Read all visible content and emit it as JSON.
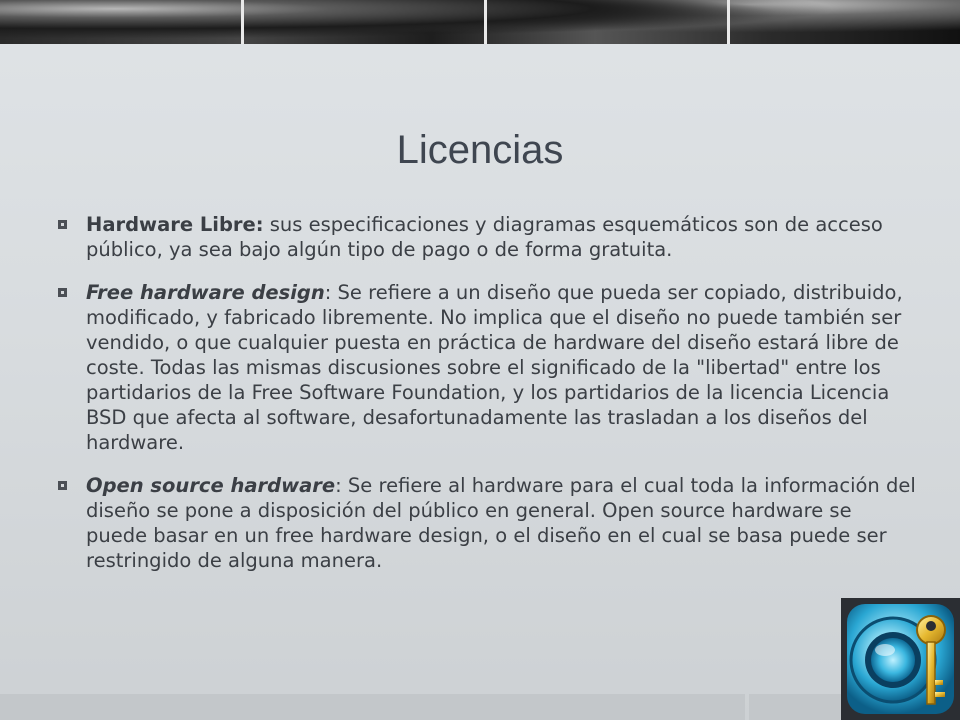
{
  "slide": {
    "title": "Licencias",
    "bullets": [
      {
        "term": "Hardware Libre:",
        "text": " sus especificaciones y diagramas esquemáticos son de acceso público, ya sea bajo algún tipo de pago o de forma gratuita."
      },
      {
        "term": "Free hardware design",
        "text": ": Se refiere a un diseño que pueda ser copiado, distribuido, modificado, y fabricado libremente. No implica que el diseño no puede también ser vendido, o que cualquier puesta en práctica de hardware del diseño estará libre de coste. Todas las mismas discusiones sobre el significado de la \"libertad\" entre los partidarios de la Free Software Foundation, y los partidarios de la licencia Licencia BSD que afecta al software, desafortunadamente las trasladan a los diseños del hardware."
      },
      {
        "term": "Open source hardware",
        "text": ": Se refiere al hardware para el cual toda la información del diseño se pone a disposición del público en general. Open source hardware se puede basar en un free hardware design, o el diseño en el cual se basa puede ser restringido de alguna manera."
      }
    ],
    "logo_icon": "key-disc-icon",
    "colors": {
      "background": "#dcdfe2",
      "title": "#3f4650",
      "text": "#3b3f45"
    }
  }
}
